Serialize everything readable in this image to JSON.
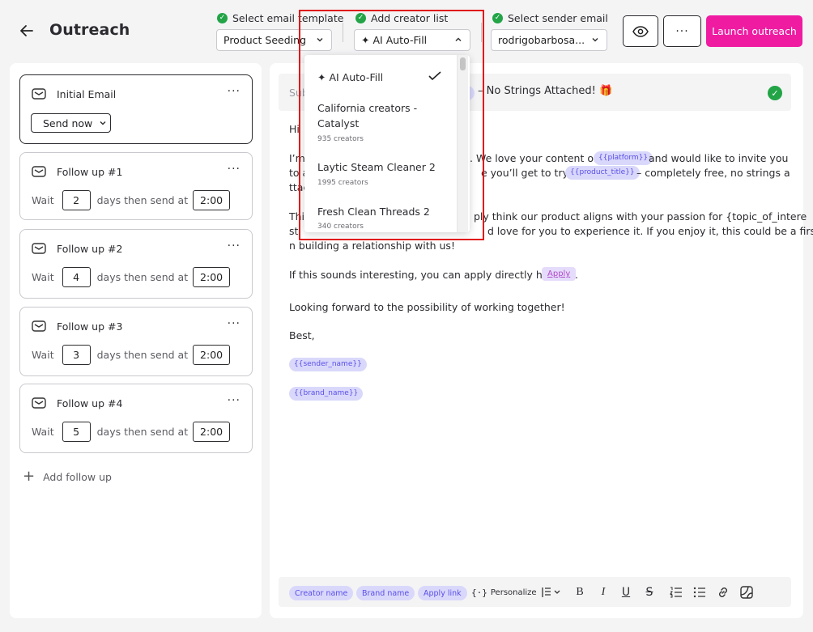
{
  "header": {
    "title": "Outreach",
    "steps": {
      "template": {
        "label": "Select email template",
        "value": "Product Seeding"
      },
      "creator_list": {
        "label": "Add creator list",
        "value": "AI Auto-Fill"
      },
      "sender": {
        "label": "Select sender email",
        "value": "rodrigobarbosa..."
      }
    },
    "launch_label": "Launch outreach"
  },
  "sequence": {
    "initial": {
      "title": "Initial Email",
      "send_label": "Send now"
    },
    "wait_label": "Wait",
    "days_label": "days then send at",
    "follow_ups": [
      {
        "title": "Follow up #1",
        "days": "2",
        "time": "2:00"
      },
      {
        "title": "Follow up #2",
        "days": "4",
        "time": "2:00"
      },
      {
        "title": "Follow up #3",
        "days": "3",
        "time": "2:00"
      },
      {
        "title": "Follow up #4",
        "days": "5",
        "time": "2:00"
      }
    ],
    "add_label": "Add follow up"
  },
  "email": {
    "subject_label": "Sub",
    "subject_text": "– No Strings Attached! 🎁",
    "line_hi": "Hi",
    "p1_a": "I’m",
    "p1_b": ". We love your content on",
    "platform_var": "{{platform}}",
    "p1_c": "and would like to invite you",
    "p2_a": "to a",
    "p2_b": "e you’ll get to try our",
    "product_var": "{{product_title}}",
    "p2_c": "– completely free, no strings a",
    "p3_a": "ttac",
    "p4_a": "Thi",
    "p4_b": "ply think our product aligns with your passion for {topic_of_intere",
    "p5_a": "st",
    "p5_b": "d love for you to experience it. If you enjoy it, this could be a first step i",
    "p6": "n building a relationship with us!",
    "apply_line": "If this sounds interesting, you can apply directly here:",
    "apply_link": "Apply",
    "apply_end": ".",
    "closing": "Looking forward to the possibility of working together!",
    "sign": "Best,",
    "sender_var": "{{sender_name}}",
    "brand_var": "{{brand_name}}"
  },
  "toolbar": {
    "chips": [
      "Creator name",
      "Brand name",
      "Apply link"
    ],
    "personalize": "Personalize"
  },
  "dropdown": {
    "items": [
      {
        "name": "AI Auto-Fill",
        "count": "",
        "selected": true
      },
      {
        "name": "California creators - Catalyst",
        "count": "935 creators"
      },
      {
        "name": "Laytic Steam Cleaner 2",
        "count": "1995 creators"
      },
      {
        "name": "Fresh Clean Threads 2",
        "count": "340 creators"
      }
    ]
  },
  "colors": {
    "accent": "#ef1ca2",
    "success": "#22a447",
    "variable_bg": "#d9d8fb",
    "variable_text": "#5b4fe8",
    "highlight": "#e01818"
  }
}
